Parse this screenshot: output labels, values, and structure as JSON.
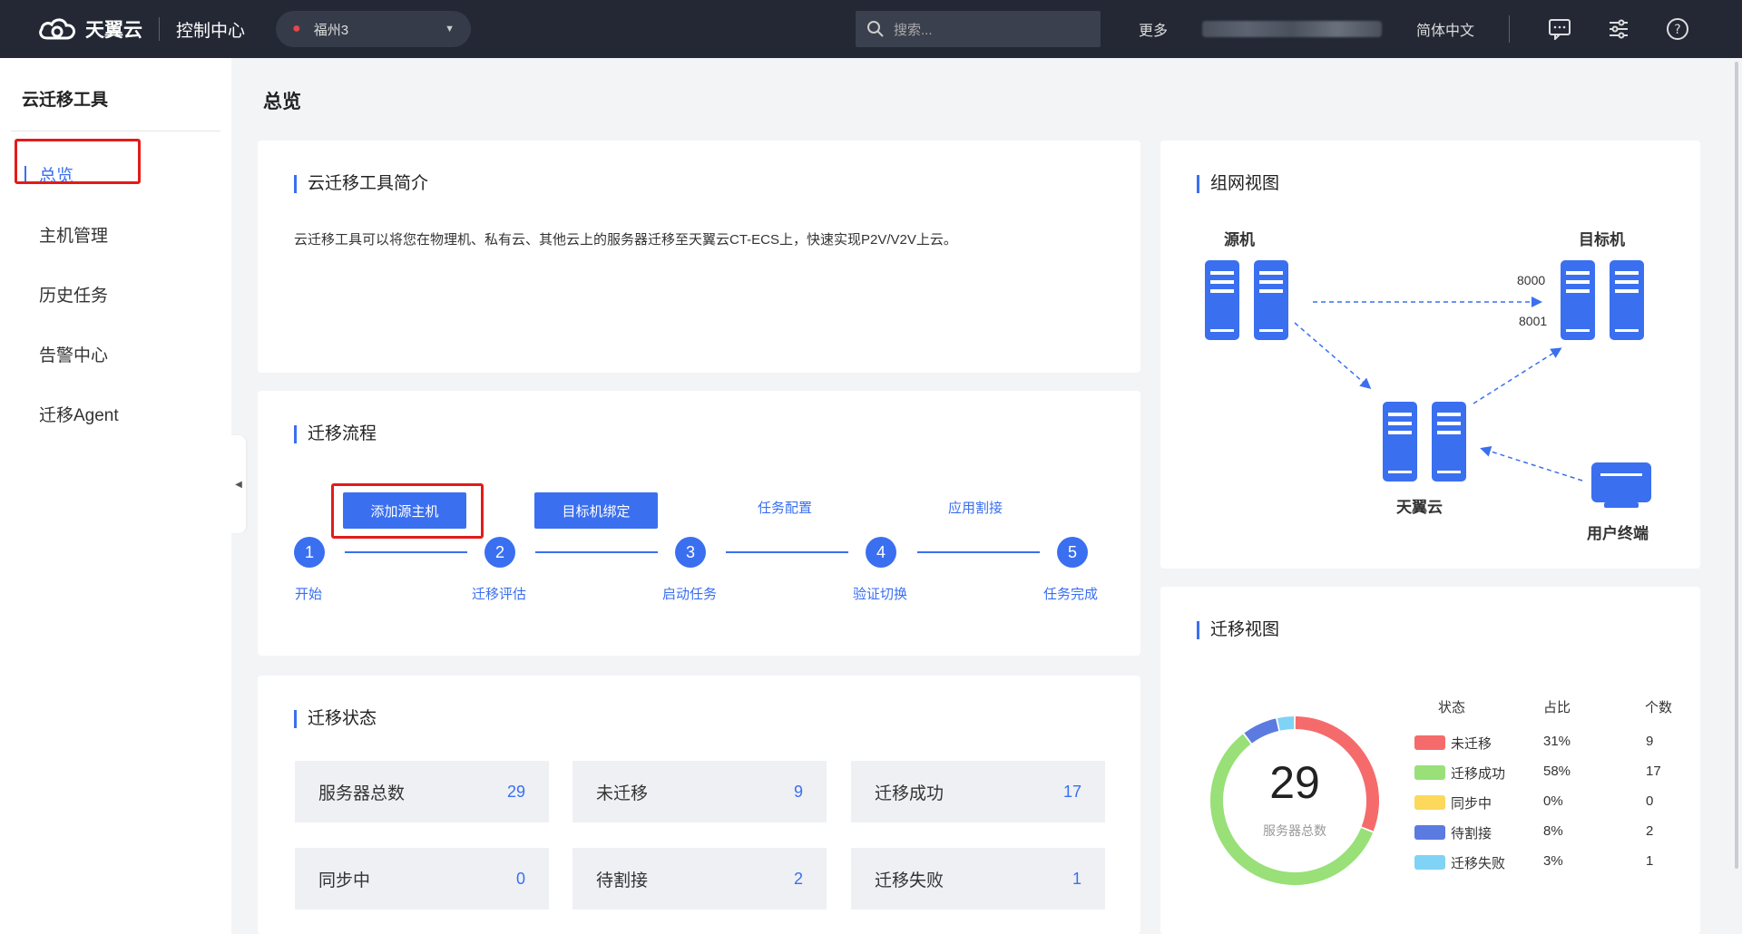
{
  "topbar": {
    "logo_text": "天翼云",
    "console_title": "控制中心",
    "region": "福州3",
    "search_placeholder": "搜索...",
    "more": "更多",
    "language": "简体中文"
  },
  "sidebar": {
    "title": "云迁移工具",
    "items": [
      {
        "label": "总览"
      },
      {
        "label": "主机管理"
      },
      {
        "label": "历史任务"
      },
      {
        "label": "告警中心"
      },
      {
        "label": "迁移Agent"
      }
    ]
  },
  "page_title": "总览",
  "intro": {
    "title": "云迁移工具简介",
    "text": "云迁移工具可以将您在物理机、私有云、其他云上的服务器迁移至天翼云CT-ECS上，快速实现P2V/V2V上云。"
  },
  "flow": {
    "title": "迁移流程",
    "actions": [
      "添加源主机",
      "目标机绑定",
      "任务配置",
      "应用割接"
    ],
    "steps": [
      {
        "num": "1",
        "label": "开始"
      },
      {
        "num": "2",
        "label": "迁移评估"
      },
      {
        "num": "3",
        "label": "启动任务"
      },
      {
        "num": "4",
        "label": "验证切换"
      },
      {
        "num": "5",
        "label": "任务完成"
      }
    ]
  },
  "status": {
    "title": "迁移状态",
    "tiles": [
      {
        "label": "服务器总数",
        "value": "29"
      },
      {
        "label": "未迁移",
        "value": "9"
      },
      {
        "label": "迁移成功",
        "value": "17"
      },
      {
        "label": "同步中",
        "value": "0"
      },
      {
        "label": "待割接",
        "value": "2"
      },
      {
        "label": "迁移失败",
        "value": "1"
      }
    ]
  },
  "network": {
    "title": "组网视图",
    "source": "源机",
    "target": "目标机",
    "cloud": "天翼云",
    "user": "用户终端",
    "port1": "8000",
    "port2": "8001"
  },
  "migration_view": {
    "title": "迁移视图",
    "total": "29",
    "total_label": "服务器总数",
    "headers": {
      "state": "状态",
      "ratio": "占比",
      "count": "个数"
    },
    "rows": [
      {
        "state": "未迁移",
        "ratio": "31%",
        "count": "9",
        "color": "#f56b6b"
      },
      {
        "state": "迁移成功",
        "ratio": "58%",
        "count": "17",
        "color": "#98e077"
      },
      {
        "state": "同步中",
        "ratio": "0%",
        "count": "0",
        "color": "#fcd85b"
      },
      {
        "state": "待割接",
        "ratio": "8%",
        "count": "2",
        "color": "#5b7be0"
      },
      {
        "state": "迁移失败",
        "ratio": "3%",
        "count": "1",
        "color": "#7fd3f5"
      }
    ]
  },
  "chart_data": {
    "type": "pie",
    "categories": [
      "未迁移",
      "迁移成功",
      "同步中",
      "待割接",
      "迁移失败"
    ],
    "values": [
      9,
      17,
      0,
      2,
      1
    ],
    "colors": [
      "#f56b6b",
      "#98e077",
      "#fcd85b",
      "#5b7be0",
      "#7fd3f5"
    ],
    "title": ""
  }
}
